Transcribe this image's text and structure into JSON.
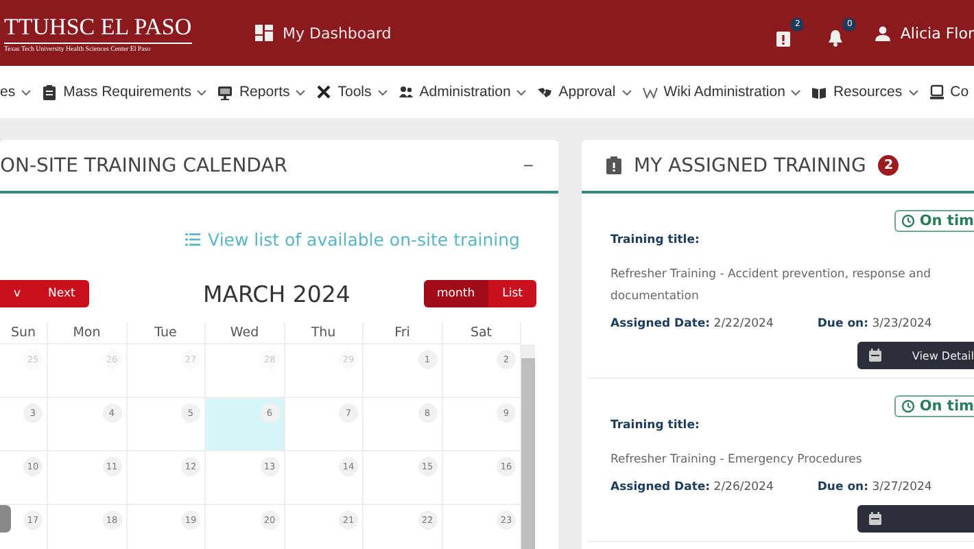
{
  "header": {
    "logo_title": "TTUHSC EL PASO",
    "logo_subtitle": "Texas Tech University Health Sciences Center El Paso",
    "dashboard_link": "My Dashboard",
    "alerts_count": "2",
    "notifications_count": "0",
    "user_name": "Alicia Flor"
  },
  "nav": [
    {
      "label": "es"
    },
    {
      "label": "Mass Requirements"
    },
    {
      "label": "Reports"
    },
    {
      "label": "Tools"
    },
    {
      "label": "Administration"
    },
    {
      "label": "Approval"
    },
    {
      "label": "Wiki Administration"
    },
    {
      "label": "Resources"
    },
    {
      "label": "Co"
    }
  ],
  "calendar": {
    "title": "ON-SITE TRAINING CALENDAR",
    "collapse": "−",
    "list_link": "View list of available on-site training",
    "prev": "v",
    "next": "Next",
    "month_title": "MARCH 2024",
    "views": [
      {
        "label": "month",
        "selected": true
      },
      {
        "label": "List",
        "selected": false
      }
    ],
    "weekdays": [
      "Sun",
      "Mon",
      "Tue",
      "Wed",
      "Thu",
      "Fri",
      "Sat"
    ],
    "weeks": [
      [
        {
          "day": "25",
          "other_month": true,
          "today": false
        },
        {
          "day": "26",
          "other_month": true,
          "today": false
        },
        {
          "day": "27",
          "other_month": true,
          "today": false
        },
        {
          "day": "28",
          "other_month": true,
          "today": false
        },
        {
          "day": "29",
          "other_month": true,
          "today": false
        },
        {
          "day": "1",
          "other_month": false,
          "today": false
        },
        {
          "day": "2",
          "other_month": false,
          "today": false
        }
      ],
      [
        {
          "day": "3",
          "other_month": false,
          "today": false
        },
        {
          "day": "4",
          "other_month": false,
          "today": false
        },
        {
          "day": "5",
          "other_month": false,
          "today": false
        },
        {
          "day": "6",
          "other_month": false,
          "today": true
        },
        {
          "day": "7",
          "other_month": false,
          "today": false
        },
        {
          "day": "8",
          "other_month": false,
          "today": false
        },
        {
          "day": "9",
          "other_month": false,
          "today": false
        }
      ],
      [
        {
          "day": "10",
          "other_month": false,
          "today": false
        },
        {
          "day": "11",
          "other_month": false,
          "today": false
        },
        {
          "day": "12",
          "other_month": false,
          "today": false
        },
        {
          "day": "13",
          "other_month": false,
          "today": false
        },
        {
          "day": "14",
          "other_month": false,
          "today": false
        },
        {
          "day": "15",
          "other_month": false,
          "today": false
        },
        {
          "day": "16",
          "other_month": false,
          "today": false
        }
      ],
      [
        {
          "day": "17",
          "other_month": false,
          "today": false
        },
        {
          "day": "18",
          "other_month": false,
          "today": false
        },
        {
          "day": "19",
          "other_month": false,
          "today": false
        },
        {
          "day": "20",
          "other_month": false,
          "today": false
        },
        {
          "day": "21",
          "other_month": false,
          "today": false
        },
        {
          "day": "22",
          "other_month": false,
          "today": false
        },
        {
          "day": "23",
          "other_month": false,
          "today": false
        }
      ]
    ]
  },
  "assigned": {
    "title": "MY ASSIGNED TRAINING",
    "count": "2",
    "items": [
      {
        "status": "On tim",
        "title_label": "Training title:",
        "title": "Refresher Training - Accident prevention, response and documentation",
        "assigned_label": "Assigned Date:",
        "assigned_date": "2/22/2024",
        "due_label": "Due on:",
        "due_date": "3/23/2024",
        "button": "View Detail"
      },
      {
        "status": "On tim",
        "title_label": "Training title:",
        "title": "Refresher Training - Emergency Procedures",
        "assigned_label": "Assigned Date:",
        "assigned_date": "2/26/2024",
        "due_label": "Due on:",
        "due_date": "3/27/2024"
      }
    ]
  }
}
